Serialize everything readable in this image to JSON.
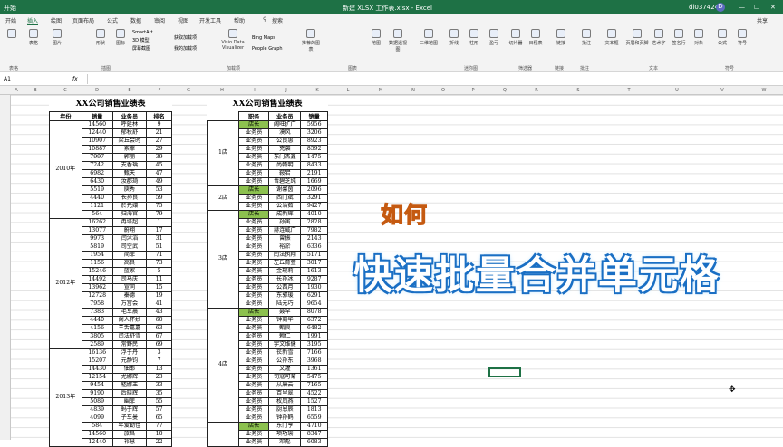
{
  "window": {
    "menu": "开始",
    "filename": "新建 XLSX 工作表.xlsx - Excel",
    "user": "dl037424",
    "avatar": "D"
  },
  "tabs": [
    "开始",
    "插入",
    "绘图",
    "页面布局",
    "公式",
    "数据",
    "审阅",
    "视图",
    "开发工具",
    "帮助"
  ],
  "search_label": "搜索",
  "share_label": "共享",
  "ribbon": {
    "groups": [
      "表格",
      "插图",
      "加载项",
      "图表",
      "迷你图",
      "筛选器",
      "链接",
      "批注",
      "文本",
      "符号"
    ],
    "buttons": [
      "数据透视表",
      "推荐的数据透视表",
      "表格",
      "图片",
      "联机图片",
      "形状",
      "图标",
      "SmartArt",
      "3D 模型",
      "屏幕截图",
      "获取加载项",
      "我的加载项",
      "Visio Data Visualizer",
      "Bing Maps",
      "People Graph",
      "推荐的图表",
      "地图",
      "数据透视图",
      "三维地图",
      "折线",
      "柱形",
      "盈亏",
      "切片器",
      "日程表",
      "链接",
      "批注",
      "文本框",
      "页眉和页脚",
      "艺术字",
      "签名行",
      "对象",
      "公式",
      "符号"
    ]
  },
  "formula_bar": {
    "cell": "A1",
    "fx": "fx"
  },
  "columns": [
    "A",
    "B",
    "C",
    "D",
    "E",
    "F",
    "G",
    "H",
    "I",
    "J",
    "K",
    "L",
    "M",
    "N",
    "O",
    "P",
    "Q",
    "R",
    "S",
    "T",
    "U",
    "V",
    "W"
  ],
  "table1": {
    "title": "XX公司销售业绩表",
    "headers": [
      "年份",
      "销量",
      "业务员",
      "排名"
    ],
    "years": [
      "2010年",
      "2012年",
      "2013年"
    ],
    "rows": [
      [
        "14560",
        "呼延林",
        "9"
      ],
      [
        "12440",
        "郁秋舒",
        "21"
      ],
      [
        "10907",
        "梁丘会时",
        "27"
      ],
      [
        "10887",
        "索霏",
        "29"
      ],
      [
        "7997",
        "郭丽",
        "39"
      ],
      [
        "7242",
        "支香瑀",
        "45"
      ],
      [
        "6982",
        "甄天",
        "47"
      ],
      [
        "6430",
        "汝郡琦",
        "49"
      ],
      [
        "5519",
        "庾秀",
        "53"
      ],
      [
        "4440",
        "长孙良",
        "59"
      ],
      [
        "1121",
        "於元嬛",
        "75"
      ],
      [
        "564",
        "归海官",
        "79"
      ],
      [
        "16262",
        "冉培超",
        "1"
      ],
      [
        "13077",
        "蔚翔",
        "17"
      ],
      [
        "9973",
        "闫沭滔",
        "31"
      ],
      [
        "5819",
        "司空武",
        "51"
      ],
      [
        "1954",
        "简菲",
        "71"
      ],
      [
        "1156",
        "高良",
        "73"
      ],
      [
        "15246",
        "蓝家",
        "5"
      ],
      [
        "14492",
        "司马庆",
        "11"
      ],
      [
        "13962",
        "宣同",
        "15"
      ],
      [
        "12728",
        "秦德",
        "19"
      ],
      [
        "7958",
        "万宫会",
        "41"
      ],
      [
        "7383",
        "毛军晨",
        "43"
      ],
      [
        "4440",
        "阚人怀妙",
        "60"
      ],
      [
        "4156",
        "羊舌嘉嘉",
        "63"
      ],
      [
        "3805",
        "闫法舒雪",
        "67"
      ],
      [
        "2589",
        "常野民",
        "69"
      ],
      [
        "16136",
        "浮于丹",
        "3"
      ],
      [
        "15207",
        "元静钧",
        "7"
      ],
      [
        "14430",
        "佃邯",
        "13"
      ],
      [
        "12154",
        "尤娜辉",
        "23"
      ],
      [
        "9454",
        "嵇娜玉",
        "33"
      ],
      [
        "9190",
        "后晓辉",
        "35"
      ],
      [
        "5089",
        "幽菲",
        "55"
      ],
      [
        "4839",
        "蚂于辉",
        "57"
      ],
      [
        "4099",
        "子车曼",
        "65"
      ],
      [
        "584",
        "年爱勤佳",
        "77"
      ],
      [
        "14560",
        "旅昌",
        "10"
      ],
      [
        "12440",
        "祁慧",
        "22"
      ]
    ]
  },
  "table2": {
    "title": "XX公司销售业绩表",
    "headers": [
      "职务",
      "业务员",
      "销量"
    ],
    "stores": [
      "1店",
      "2店",
      "3店",
      "4店"
    ],
    "rows": [
      [
        "店长",
        "阔旺扩广",
        "5956"
      ],
      [
        "业务员",
        "漠风",
        "3206"
      ],
      [
        "业务员",
        "公良惠",
        "8923"
      ],
      [
        "业务员",
        "充袭",
        "8592"
      ],
      [
        "业务员",
        "东门杰鑫",
        "1475"
      ],
      [
        "业务员",
        "尚畅明",
        "8433"
      ],
      [
        "业务员",
        "鞍宕",
        "2191"
      ],
      [
        "业务员",
        "晋碧芝纯",
        "1669"
      ],
      [
        "店长",
        "谢馨茵",
        "2096"
      ],
      [
        "业务员",
        "西门斌",
        "3291"
      ],
      [
        "业务员",
        "公治茹",
        "9427"
      ],
      [
        "店长",
        "成新辉",
        "4010"
      ],
      [
        "业务员",
        "孙寅",
        "2828"
      ],
      [
        "业务员",
        "赫连威广",
        "7982"
      ],
      [
        "业务员",
        "曾振",
        "2143"
      ],
      [
        "业务员",
        "裕淤",
        "6336"
      ],
      [
        "业务员",
        "闫法执翔",
        "5171"
      ],
      [
        "业务员",
        "左丘育萱",
        "3017"
      ],
      [
        "业务员",
        "金琬莉",
        "1613"
      ],
      [
        "业务员",
        "长孙冰",
        "9287"
      ],
      [
        "业务员",
        "公西月",
        "1930"
      ],
      [
        "业务员",
        "东郭瑗",
        "6291"
      ],
      [
        "业务员",
        "陆元巧",
        "9654"
      ],
      [
        "店长",
        "聂罕",
        "8078"
      ],
      [
        "业务员",
        "钟离华",
        "6372"
      ],
      [
        "业务员",
        "甄良",
        "6482"
      ],
      [
        "业务员",
        "赖仁",
        "1991"
      ],
      [
        "业务员",
        "宇文维健",
        "3195"
      ],
      [
        "业务员",
        "苌新雪",
        "7166"
      ],
      [
        "业务员",
        "公孙东",
        "3968"
      ],
      [
        "业务员",
        "文灌",
        "1361"
      ],
      [
        "业务员",
        "司寇可菊",
        "5475"
      ],
      [
        "业务员",
        "从康云",
        "7165"
      ],
      [
        "业务员",
        "百里翠",
        "4522"
      ],
      [
        "业务员",
        "枚凤燕",
        "1527"
      ],
      [
        "业务员",
        "厨恩辰",
        "1813"
      ],
      [
        "业务员",
        "钟孙鹤",
        "6559"
      ],
      [
        "店长",
        "东门亨",
        "4710"
      ],
      [
        "业务员",
        "项功瑜",
        "8347"
      ],
      [
        "业务员",
        "邓彪",
        "6083"
      ]
    ]
  },
  "overlay": {
    "line1": "如何",
    "line2": "快速批量合并单元格"
  }
}
